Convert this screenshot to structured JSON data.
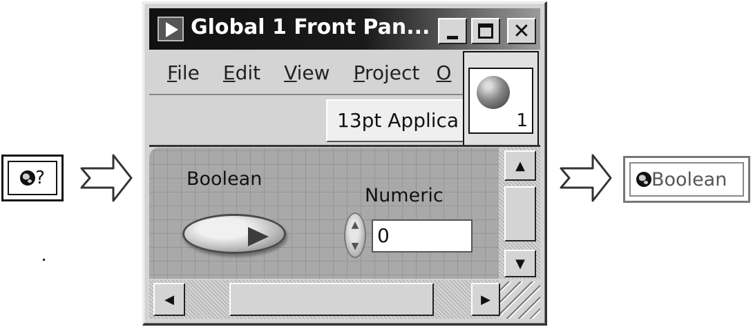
{
  "left_node": {
    "glyph": "?",
    "icon": "globe-icon"
  },
  "window": {
    "title": "Global 1 Front Pan...",
    "title_icon": "labview-vi-icon",
    "controls": {
      "minimize": "minimize",
      "maximize": "maximize",
      "close": "✕"
    },
    "menu": [
      {
        "underline": "F",
        "rest": "ile"
      },
      {
        "underline": "E",
        "rest": "dit"
      },
      {
        "underline": "V",
        "rest": "iew"
      },
      {
        "underline": "P",
        "rest": "roject"
      },
      {
        "underline": "O",
        "rest": ""
      }
    ],
    "font_dropdown": "13pt Applica",
    "palette": {
      "icon": "global-variable-ball-icon",
      "count": "1"
    },
    "panel": {
      "boolean_label": "Boolean",
      "numeric_label": "Numeric",
      "numeric_value": "0"
    },
    "scrollbars": {
      "up": "▲",
      "down": "▼",
      "left": "◀",
      "right": "▶"
    }
  },
  "right_node": {
    "label": "Boolean",
    "icon": "globe-icon"
  }
}
